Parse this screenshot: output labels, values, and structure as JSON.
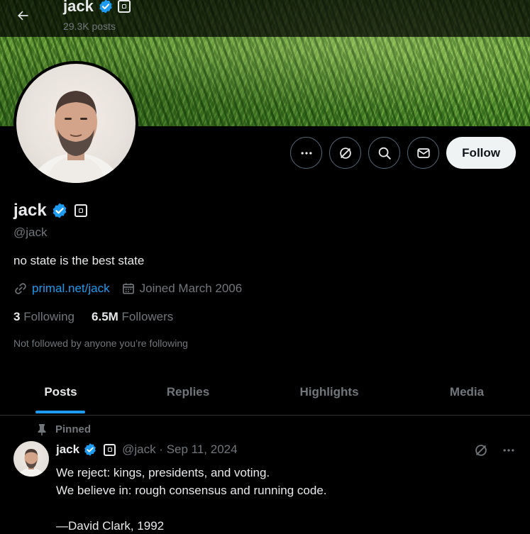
{
  "header": {
    "display_name": "jack",
    "post_count": "29.3K posts"
  },
  "profile": {
    "display_name": "jack",
    "handle": "@jack",
    "bio": "no state is the best state",
    "link": "primal.net/jack",
    "joined": "Joined March 2006",
    "following_count": "3",
    "following_label": "Following",
    "followers_count": "6.5M",
    "followers_label": "Followers",
    "not_followed_text": "Not followed by anyone you’re following"
  },
  "actions": {
    "follow_label": "Follow"
  },
  "tabs": [
    {
      "label": "Posts",
      "active": true
    },
    {
      "label": "Replies",
      "active": false
    },
    {
      "label": "Highlights",
      "active": false
    },
    {
      "label": "Media",
      "active": false
    }
  ],
  "pinned_post": {
    "pinned_label": "Pinned",
    "author": "jack",
    "meta": "@jack · Sep 11, 2024",
    "lines": [
      "We reject: kings, presidents, and voting.",
      "We believe in: rough consensus and running code.",
      "",
      "—David Clark, 1992"
    ]
  },
  "colors": {
    "accent": "#1d9bf0",
    "background": "#000000",
    "text_primary": "#e7e9ea",
    "text_secondary": "#71767b",
    "follow_button_bg": "#eff3f4"
  },
  "icons": [
    "back-arrow-icon",
    "verified-badge-icon",
    "square-affiliate-icon",
    "more-icon",
    "nostr-icon",
    "search-icon",
    "mail-icon",
    "link-icon",
    "calendar-icon",
    "pin-icon"
  ]
}
